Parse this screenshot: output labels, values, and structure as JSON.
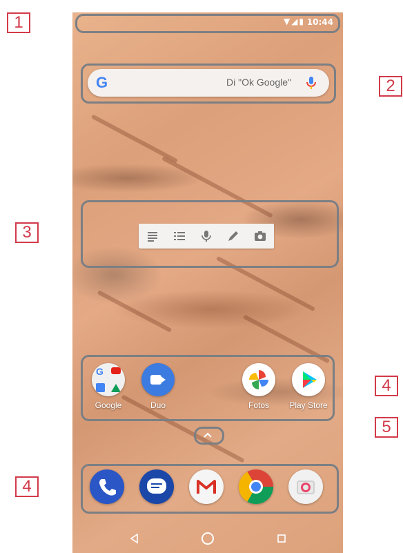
{
  "callouts": [
    "1",
    "2",
    "3",
    "4",
    "5",
    "4"
  ],
  "status": {
    "time": "10:44",
    "icons": "▼◢▮"
  },
  "search": {
    "logo": "G",
    "placeholder": "Di \"Ok Google\""
  },
  "keep_toolbar": [
    "text-note-icon",
    "list-icon",
    "mic-icon",
    "pen-icon",
    "camera-icon"
  ],
  "apps": [
    {
      "label": "Google"
    },
    {
      "label": "Duo"
    },
    {
      "label": "Fotos"
    },
    {
      "label": "Play Store"
    }
  ],
  "dock": [
    "phone-icon",
    "messages-icon",
    "gmail-icon",
    "chrome-icon",
    "camera-app-icon"
  ],
  "colors": {
    "callout": "#d23a4a",
    "highlight": "#7b7f84"
  }
}
